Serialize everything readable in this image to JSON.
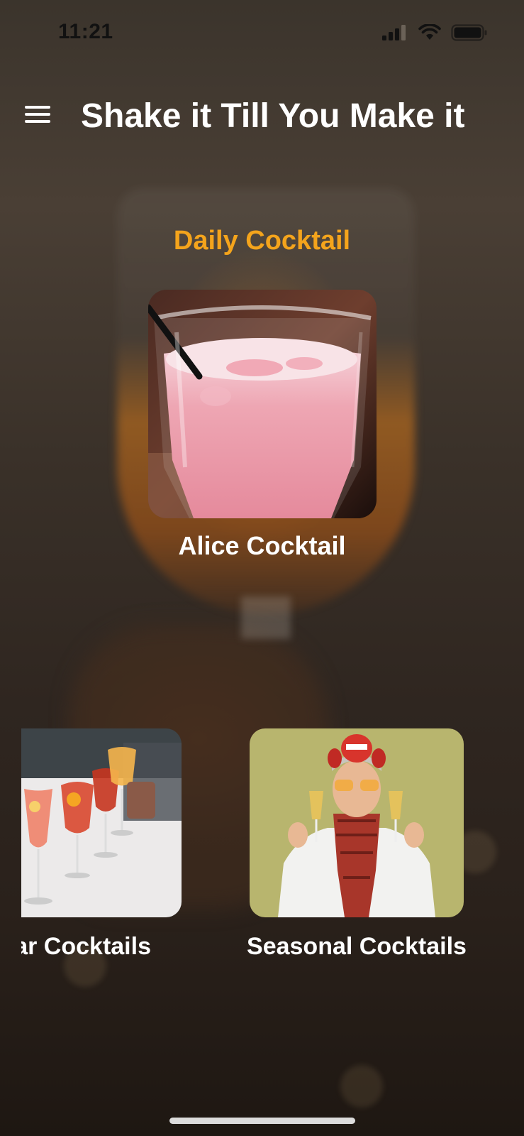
{
  "status_bar": {
    "time": "11:21",
    "icons": [
      "cellular-signal-icon",
      "wifi-icon",
      "battery-icon"
    ]
  },
  "header": {
    "menu_icon": "hamburger-menu-icon",
    "title": "Shake it Till You Make it"
  },
  "daily": {
    "heading": "Daily Cocktail",
    "drink_name": "Alice Cocktail",
    "image": "pink frothy cocktail in glass with black straw"
  },
  "categories": [
    {
      "label": "Popular Cocktails",
      "visible_label": "ular Cocktails",
      "image": "assorted cocktails on white table"
    },
    {
      "label": "Seasonal Cocktails",
      "image": "man in festive scarf and reindeer headband holding champagne glasses"
    }
  ],
  "colors": {
    "accent": "#f4a41c",
    "title_text": "#ffffff",
    "status_text": "#111111",
    "home_indicator": "#dcdcdc"
  }
}
